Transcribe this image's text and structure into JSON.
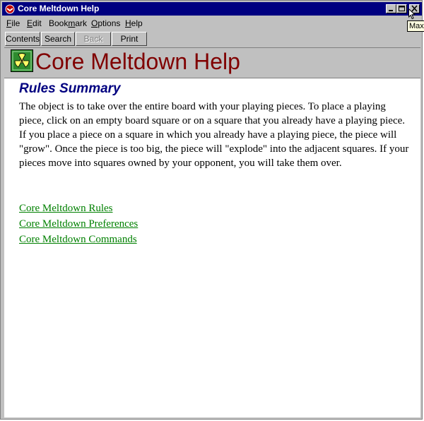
{
  "window": {
    "title": "Core Meltdown Help",
    "controls": [
      "minimize",
      "maximize",
      "close"
    ]
  },
  "tooltip": {
    "text": "Maximize"
  },
  "menu": {
    "items": [
      {
        "label": "File",
        "access": "F"
      },
      {
        "label": "Edit",
        "access": "E"
      },
      {
        "label": "Bookmark",
        "access": "m"
      },
      {
        "label": "Options",
        "access": "O"
      },
      {
        "label": "Help",
        "access": "H"
      }
    ]
  },
  "toolbar": {
    "contents": "Contents",
    "search": "Search",
    "back": "Back",
    "print": "Print"
  },
  "banner": {
    "title": "Core Meltdown Help",
    "icon": "radiation-icon"
  },
  "content": {
    "heading": "Rules Summary",
    "paragraph": "The object is to take over the entire board with your playing pieces. To place a playing piece, click on an empty board square or on a square that you already have a playing piece. If you place a piece on a square in which you already have a playing piece, the piece will \"grow\". Once the piece is too big, the piece will \"explode\" into the adjacent squares. If your pieces move into squares owned by your opponent, you will take them over.",
    "links": [
      "Core Meltdown Rules",
      "Core Meltdown Preferences ",
      "Core Meltdown Commands"
    ]
  },
  "colors": {
    "titlebar": "#000080",
    "banner_title": "#800000",
    "heading": "#000080",
    "link": "#008000",
    "chrome": "#c0c0c0"
  }
}
